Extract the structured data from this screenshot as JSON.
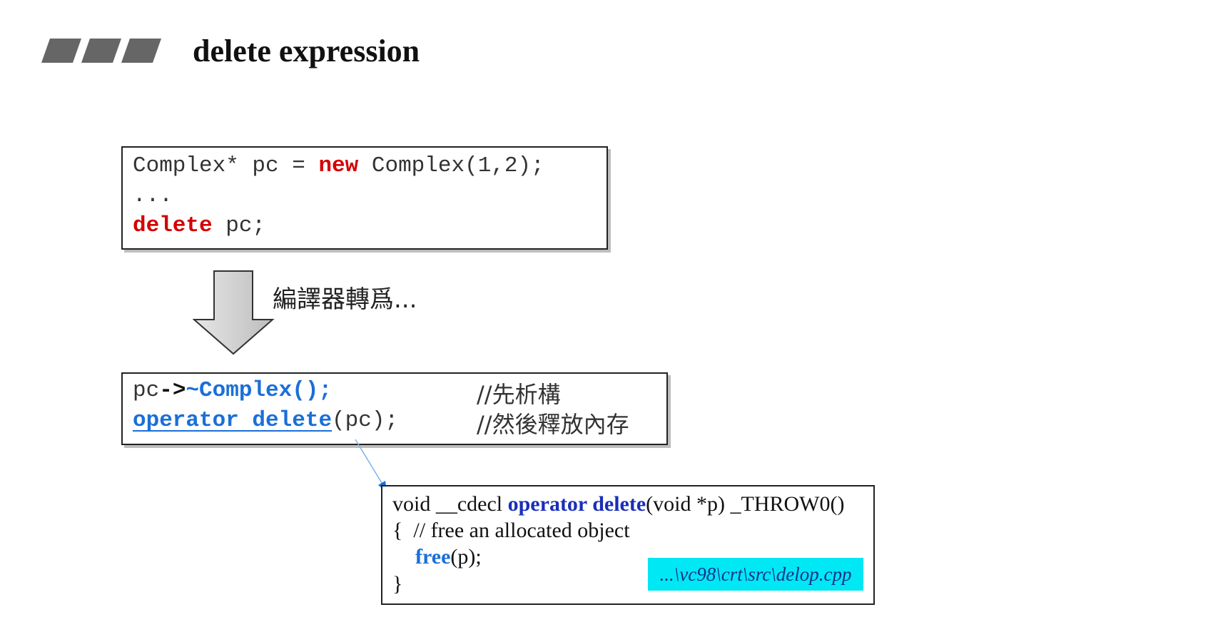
{
  "header": {
    "title": "delete expression"
  },
  "code_original": {
    "line1": {
      "before": "Complex* pc = ",
      "keyword": "new",
      "after": " Complex(1,2);"
    },
    "line2": "...",
    "line3": {
      "keyword": "delete",
      "after": " pc;"
    }
  },
  "transform": {
    "label": "編譯器轉爲..."
  },
  "code_translated": {
    "line1": {
      "obj": "pc",
      "arrow": "->",
      "call": "~Complex",
      "args": "();",
      "comment": "//先析構"
    },
    "line2": {
      "call": "operator delete",
      "args": "(pc);",
      "comment": "//然後釋放內存"
    }
  },
  "source_code": {
    "line1": {
      "prefix": "void __cdecl ",
      "keyword": "operator delete",
      "suffix": "(void *p) _THROW0()"
    },
    "line2": "{  // free an allocated object",
    "line3": {
      "keyword": "free",
      "suffix": "(p);"
    },
    "line4": "}",
    "file_path": "...\\vc98\\crt\\src\\delop.cpp"
  },
  "colors": {
    "keyword_red": "#d40000",
    "keyword_blue": "#1a6fd8",
    "source_keyword": "#1a2fb8",
    "path_highlight": "#00e8f4"
  }
}
